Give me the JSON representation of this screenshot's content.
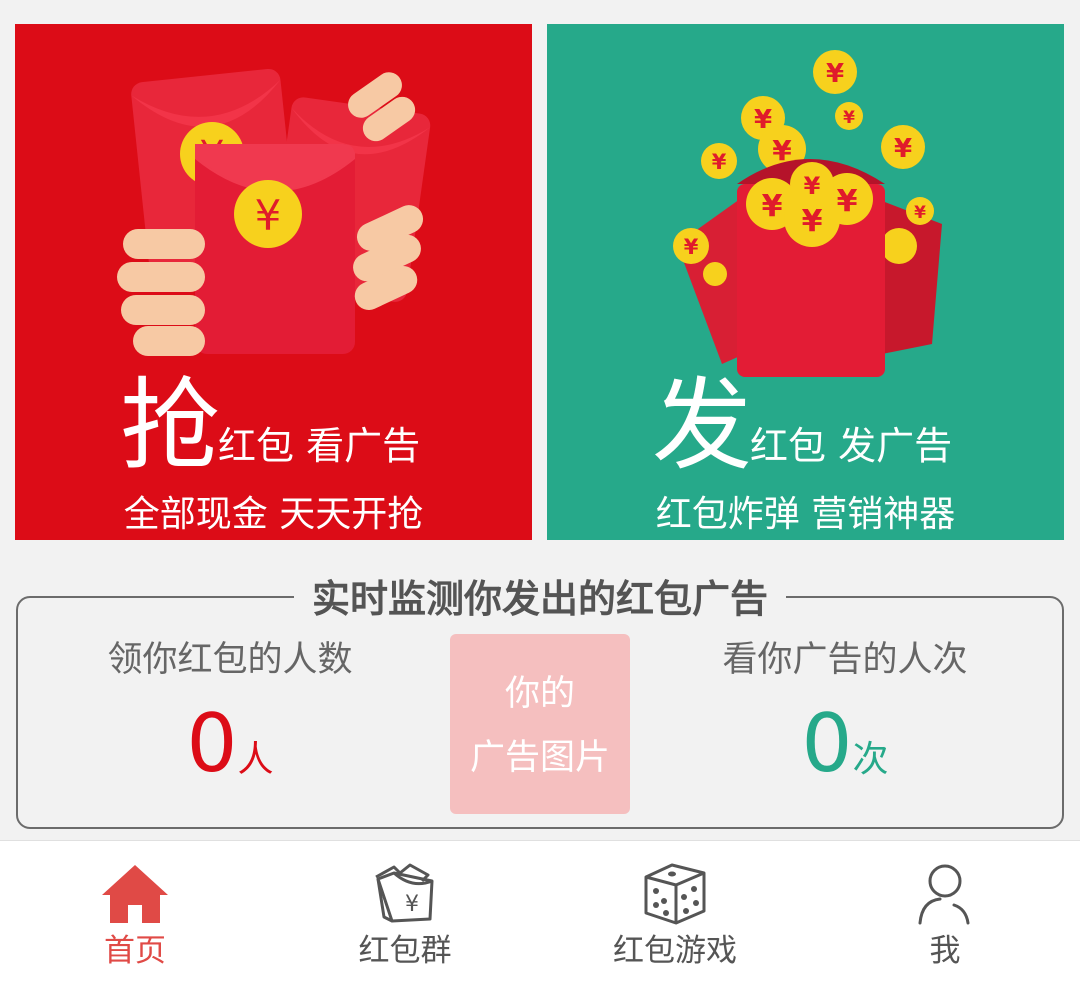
{
  "cards": {
    "grab": {
      "big_char": "抢",
      "subtitle": "红包 看广告",
      "tagline": "全部现金 天天开抢",
      "coin_symbol": "¥",
      "bg_color": "#dc0c17"
    },
    "send": {
      "big_char": "发",
      "subtitle": "红包 发广告",
      "tagline": "红包炸弹 营销神器",
      "coin_symbol": "¥",
      "bg_color": "#26a98a"
    }
  },
  "monitor": {
    "title": "实时监测你发出的红包广告",
    "left": {
      "label": "领你红包的人数",
      "value": "0",
      "unit": "人",
      "color": "#dc0c17"
    },
    "right": {
      "label": "看你广告的人次",
      "value": "0",
      "unit": "次",
      "color": "#26a98a"
    },
    "ad_box": {
      "line1": "你的",
      "line2": "广告图片"
    }
  },
  "tabbar": {
    "active_color": "#e04a46",
    "items": [
      {
        "label": "首页",
        "icon": "home-icon",
        "active": true
      },
      {
        "label": "红包群",
        "icon": "red-packet-group-icon",
        "coin_symbol": "¥",
        "active": false
      },
      {
        "label": "红包游戏",
        "icon": "dice-icon",
        "active": false
      },
      {
        "label": "我",
        "icon": "user-icon",
        "active": false
      }
    ]
  }
}
